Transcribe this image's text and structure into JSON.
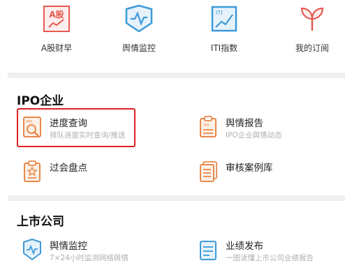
{
  "quick_nav": {
    "items": [
      {
        "label": "A股财早",
        "icon": "a-share-morning-icon"
      },
      {
        "label": "舆情监控",
        "icon": "sentiment-monitor-icon"
      },
      {
        "label": "ITI指数",
        "icon": "iti-index-icon"
      },
      {
        "label": "我的订阅",
        "icon": "subscription-sprout-icon"
      }
    ]
  },
  "ipo_section": {
    "title": "IPO企业",
    "features": [
      {
        "title": "进度查询",
        "subtitle": "排队进度实时查询/推送",
        "icon": "progress-query-icon"
      },
      {
        "title": "舆情报告",
        "subtitle": "IPO企业舆情动态",
        "icon": "sentiment-report-icon"
      },
      {
        "title": "过会盘点",
        "subtitle": "",
        "icon": "meeting-review-icon"
      },
      {
        "title": "审核案例库",
        "subtitle": "",
        "icon": "case-library-icon"
      }
    ]
  },
  "listed_section": {
    "title": "上市公司",
    "features": [
      {
        "title": "舆情监控",
        "subtitle": "7×24小时监测网络舆情",
        "icon": "sentiment-monitor-icon"
      },
      {
        "title": "业绩发布",
        "subtitle": "一图读懂上市公司业绩报告",
        "icon": "earnings-release-icon"
      }
    ]
  },
  "colors": {
    "accent_orange": "#e8894a",
    "accent_blue": "#3d9ad8",
    "accent_red": "#e45a4f",
    "highlight_red": "#e02020"
  }
}
